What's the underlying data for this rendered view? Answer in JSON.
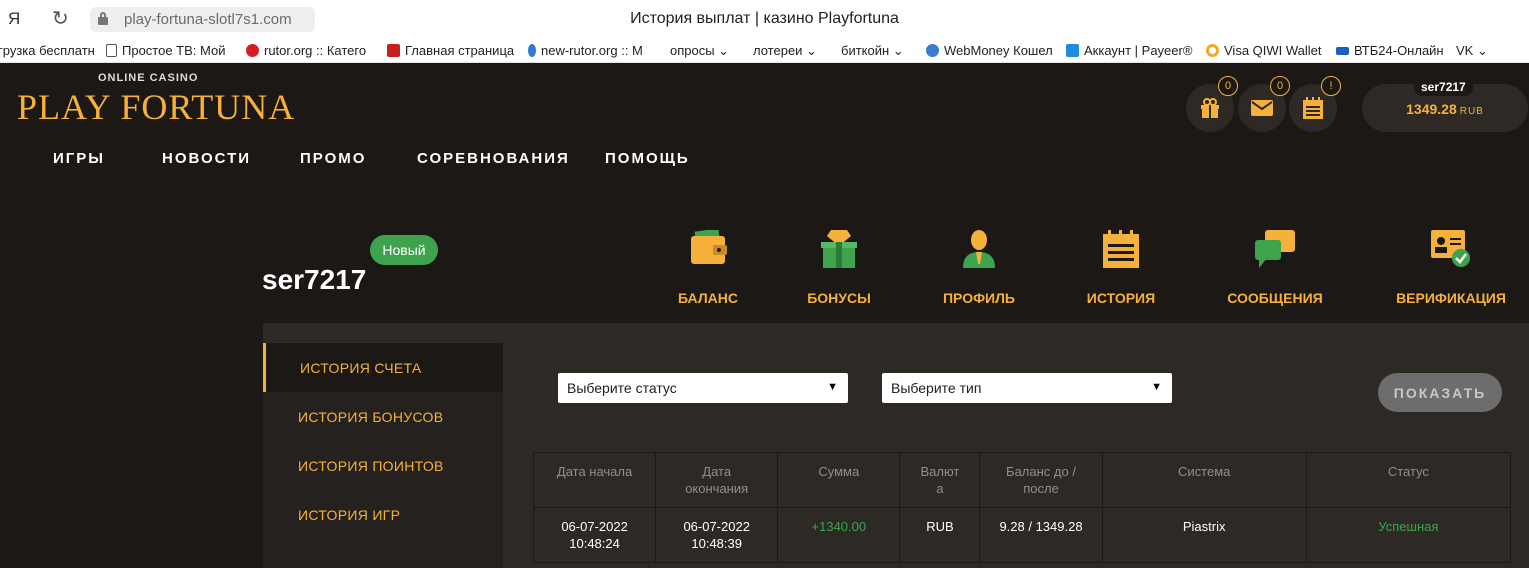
{
  "browser": {
    "ya_glyph": "Я",
    "reload_glyph": "↻",
    "url": "play-fortuna-slotl7s1.com",
    "tab_title": "История выплат | казино Playfortuna",
    "bookmarks": [
      {
        "label": "грузка бесплатн",
        "icon": "none",
        "color": ""
      },
      {
        "label": "Простое ТВ: Мой",
        "icon": "page-icon",
        "color": "#888888"
      },
      {
        "label": "rutor.org :: Катего",
        "icon": "rutor-icon",
        "color": "#d02020"
      },
      {
        "label": "Главная страница",
        "icon": "site-icon",
        "color": "#c82020"
      },
      {
        "label": "new-rutor.org :: М",
        "icon": "rutor-icon",
        "color": "#2a7bd6"
      },
      {
        "label": "опросы ⌄",
        "icon": "none",
        "color": ""
      },
      {
        "label": "лотереи ⌄",
        "icon": "none",
        "color": ""
      },
      {
        "label": "биткойн ⌄",
        "icon": "none",
        "color": ""
      },
      {
        "label": "WebMoney Кошел",
        "icon": "webmoney-icon",
        "color": "#3b7bd4"
      },
      {
        "label": "Аккаунт | Payeer®",
        "icon": "payeer-icon",
        "color": "#1e8de0"
      },
      {
        "label": "Visa QIWI Wallet",
        "icon": "qiwi-icon",
        "color": "#f5a623"
      },
      {
        "label": "ВТБ24-Онлайн",
        "icon": "vtb-icon",
        "color": "#1a5fbf"
      },
      {
        "label": "VK ⌄",
        "icon": "none",
        "color": ""
      }
    ]
  },
  "site": {
    "logo_top": "ONLINE CASINO",
    "logo_main": "PLAY FORTUNA",
    "nav": [
      "ИГРЫ",
      "НОВОСТИ",
      "ПРОМО",
      "СОРЕВНОВАНИЯ",
      "ПОМОЩЬ"
    ],
    "counters": {
      "gifts": "0",
      "messages": "0",
      "notes": "!"
    },
    "user": {
      "name": "ser7217",
      "balance": "1349.28",
      "currency": "RUB"
    },
    "accent_color": "#f6b13a"
  },
  "profile": {
    "name": "ser7217",
    "badge": "Новый",
    "tabs": [
      {
        "label": "БАЛАНС",
        "icon": "wallet-icon"
      },
      {
        "label": "БОНУСЫ",
        "icon": "gift-box-icon"
      },
      {
        "label": "ПРОФИЛЬ",
        "icon": "person-icon"
      },
      {
        "label": "ИСТОРИЯ",
        "icon": "notepad-icon",
        "active": true
      },
      {
        "label": "СООБЩЕНИЯ",
        "icon": "chat-icon"
      },
      {
        "label": "ВЕРИФИКАЦИЯ",
        "icon": "id-card-check-icon"
      }
    ]
  },
  "history": {
    "sidebar": [
      "ИСТОРИЯ СЧЕТА",
      "ИСТОРИЯ БОНУСОВ",
      "ИСТОРИЯ ПОИНТОВ",
      "ИСТОРИЯ ИГР"
    ],
    "status_select": "Выберите статус",
    "type_select": "Выберите тип",
    "show_button": "ПОКАЗАТЬ",
    "columns": [
      "Дата начала",
      "Дата окончания",
      "Сумма",
      "Валюта",
      "Баланс до / после",
      "Система",
      "Статус"
    ],
    "column_lines": [
      [
        "Дата начала"
      ],
      [
        "Дата",
        "окончания"
      ],
      [
        "Сумма"
      ],
      [
        "Валют",
        "а"
      ],
      [
        "Баланс до /",
        "после"
      ],
      [
        "Система"
      ],
      [
        "Статус"
      ]
    ],
    "rows": [
      {
        "start": [
          "06-07-2022",
          "10:48:24"
        ],
        "end": [
          "06-07-2022",
          "10:48:39"
        ],
        "amount": "+1340.00",
        "currency": "RUB",
        "balance": "9.28 / 1349.28",
        "system": "Piastrix",
        "status": "Успешная"
      }
    ]
  }
}
